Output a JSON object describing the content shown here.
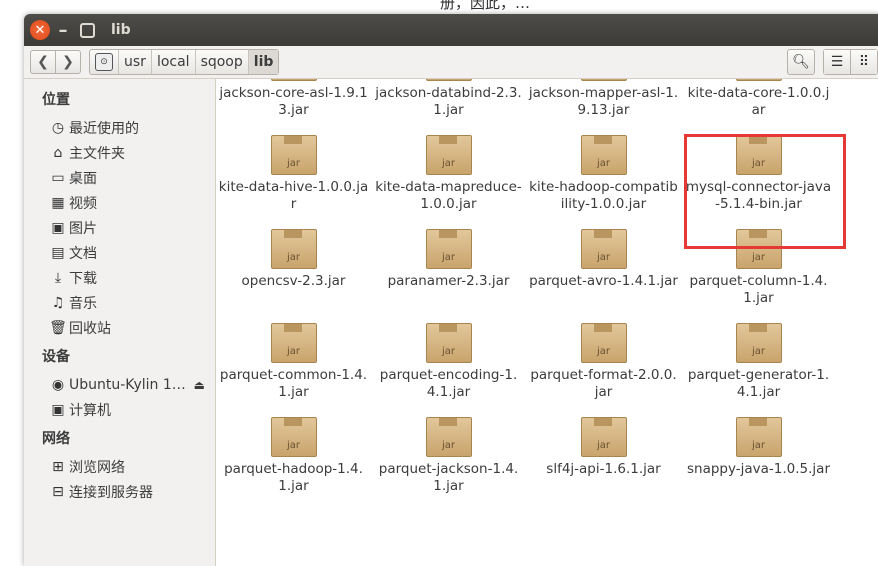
{
  "top_text": "册，因此，…",
  "window": {
    "title": "lib"
  },
  "breadcrumbs": [
    "usr",
    "local",
    "sqoop",
    "lib"
  ],
  "sidebar": {
    "sections": [
      {
        "heading": "位置",
        "items": [
          {
            "label": "最近使用的",
            "icon": "clock-icon"
          },
          {
            "label": "主文件夹",
            "icon": "home-icon"
          },
          {
            "label": "桌面",
            "icon": "desktop-icon"
          },
          {
            "label": "视频",
            "icon": "video-icon"
          },
          {
            "label": "图片",
            "icon": "picture-icon"
          },
          {
            "label": "文档",
            "icon": "document-icon"
          },
          {
            "label": "下载",
            "icon": "download-icon"
          },
          {
            "label": "音乐",
            "icon": "music-icon"
          },
          {
            "label": "回收站",
            "icon": "trash-icon"
          }
        ]
      },
      {
        "heading": "设备",
        "items": [
          {
            "label": "Ubuntu-Kylin 1…",
            "icon": "disc-icon"
          },
          {
            "label": "计算机",
            "icon": "computer-icon"
          }
        ]
      },
      {
        "heading": "网络",
        "items": [
          {
            "label": "浏览网络",
            "icon": "network-icon"
          },
          {
            "label": "连接到服务器",
            "icon": "server-icon"
          }
        ]
      }
    ]
  },
  "files": [
    {
      "name": "jackson-core-asl-1.9.13.jar"
    },
    {
      "name": "jackson-databind-2.3.1.jar"
    },
    {
      "name": "jackson-mapper-asl-1.9.13.jar"
    },
    {
      "name": "kite-data-core-1.0.0.jar"
    },
    {
      "name": "kite-data-hive-1.0.0.jar"
    },
    {
      "name": "kite-data-mapreduce-1.0.0.jar"
    },
    {
      "name": "kite-hadoop-compatibility-1.0.0.jar"
    },
    {
      "name": "mysql-connector-java-5.1.4-bin.jar"
    },
    {
      "name": "opencsv-2.3.jar"
    },
    {
      "name": "paranamer-2.3.jar"
    },
    {
      "name": "parquet-avro-1.4.1.jar"
    },
    {
      "name": "parquet-column-1.4.1.jar"
    },
    {
      "name": "parquet-common-1.4.1.jar"
    },
    {
      "name": "parquet-encoding-1.4.1.jar"
    },
    {
      "name": "parquet-format-2.0.0.jar"
    },
    {
      "name": "parquet-generator-1.4.1.jar"
    },
    {
      "name": "parquet-hadoop-1.4.1.jar"
    },
    {
      "name": "parquet-jackson-1.4.1.jar"
    },
    {
      "name": "slf4j-api-1.6.1.jar"
    },
    {
      "name": "snappy-java-1.0.5.jar"
    }
  ],
  "jar_label": "jar"
}
